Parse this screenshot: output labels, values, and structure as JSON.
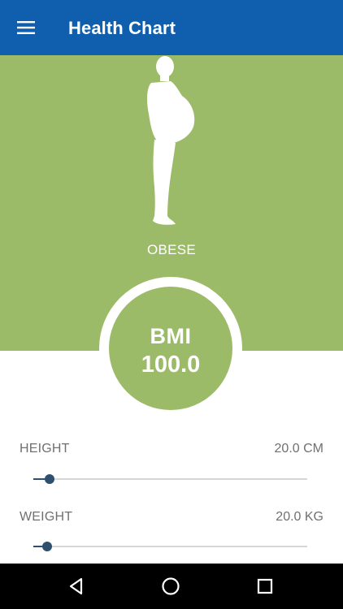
{
  "appbar": {
    "title": "Health Chart",
    "menu_icon": "hamburger-menu-icon",
    "background": "#0f5fae"
  },
  "hero": {
    "background": "#9cbb68",
    "figure_icon": "obese-person-silhouette-icon",
    "status": "OBESE"
  },
  "bmi": {
    "label": "BMI",
    "value": "100.0"
  },
  "height_slider": {
    "label": "HEIGHT",
    "value": "20.0 CM",
    "fraction": 0.06
  },
  "weight_slider": {
    "label": "WEIGHT",
    "value": "20.0 KG",
    "fraction": 0.05
  },
  "navbar": {
    "back_icon": "back-triangle-icon",
    "home_icon": "home-circle-icon",
    "recents_icon": "recents-square-icon"
  },
  "colors": {
    "accent_green": "#9cbb68",
    "slider_active": "#2f4f6f",
    "slider_track": "#d6d6d6",
    "label_text": "#707070"
  }
}
